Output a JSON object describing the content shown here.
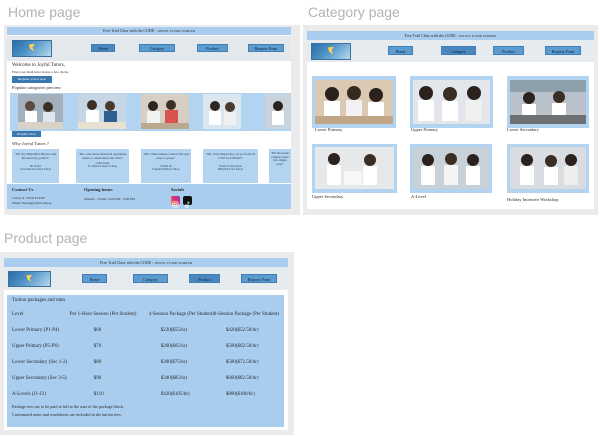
{
  "frames": {
    "home": "Home page",
    "category": "Category page",
    "product": "Product page"
  },
  "site": {
    "banner_text": "Free Trail Class with the CODE : ",
    "banner_code": "JOYFUL TUTOR STARTER",
    "logo_text": "Joyful Tutors",
    "nav": [
      "Home",
      "Category",
      "Product",
      "Request Form"
    ],
    "colors": {
      "banner": "#a9cdee",
      "button": "#5b9bd0",
      "card": "#b3d4f1",
      "dark_button": "#3a78b0"
    }
  },
  "home": {
    "welcome": "Welcome to Joyful Tutors,",
    "subtitle": "Find your ideal tutor in just a few clicks.",
    "cta": "Request a tutor now",
    "popular_title": "Popular categories preview",
    "enquire": "Enquire Now",
    "why_title": "Why Joyful Tutors ?",
    "testimonials": [
      {
        "quote": "\"Mr Ng Simplified Physics and Boosted my grades!\"",
        "author": "Ho Jie Yee",
        "school": "Townsville Secondary School"
      },
      {
        "quote": "\"Ms. Goh made historical arguments easier to understand and write\"",
        "author": "Lillian Wong",
        "school": "St. Andrew's Junior College"
      },
      {
        "quote": "\"Mrs. Hana makes science fun and easy to grasp.\"",
        "author": "Tai Wei Jie",
        "school": "Edgefield Primary School"
      },
      {
        "quote": "\"Ms. Chia helped my son go from C6 to B3 in A Maths!\"",
        "author": "Parent of Cheryl Koh",
        "school": "Bukit Batok Sec School"
      },
      {
        "quote": "\"Mr Tan breaks complex ideas into simple ways\"",
        "author": "",
        "school": ""
      }
    ],
    "contact_title": "Contact Us",
    "phone": "Call us at +65 6123 4567",
    "email": "Email: Tutors@joyful.com.sg",
    "hours_title": "Opening hours",
    "hours": "Monday – Friday: 2:00 PM – 9:00 PM",
    "socials_title": "Socials",
    "social_icons": [
      "instagram-icon",
      "tiktok-icon"
    ]
  },
  "category": {
    "items": [
      "Lower Primary",
      "Upper Primary",
      "Lower Secondary",
      "Upper Secondary",
      "A-Level",
      "Holiday Intensive Workshop"
    ]
  },
  "product": {
    "heading": "Tuition packages and rates",
    "columns": [
      "Level",
      "Per 1-Hour Session (Per Student)",
      "4-Session Package (Per Student)",
      "8-Session Package (Per Student)"
    ],
    "rows": [
      [
        "Lower Primary (P1-P4)",
        "$60",
        "$220($55/hr)",
        "$420($52.50/hr)"
      ],
      [
        "Upper Primary (P5-P6)",
        "$70",
        "$260($65/hr)",
        "$500($62.50/hr)"
      ],
      [
        "Lower Secondary (Sec 1-2)",
        "$80",
        "$300($75/hr)",
        "$580($72.50/hr)"
      ],
      [
        "Upper Secondary (Sec 3-5)",
        "$90",
        "$340($85/hr)",
        "$660($82.50/hr)"
      ],
      [
        "A-Levels (J1-J2)",
        "$110",
        "$420($105/hr)",
        "$800($100/hr)"
      ]
    ],
    "note1": "Package fees are to be paid in full at the start of the package block.",
    "note2": "Customized notes and worksheets are included in the tuition fees."
  }
}
